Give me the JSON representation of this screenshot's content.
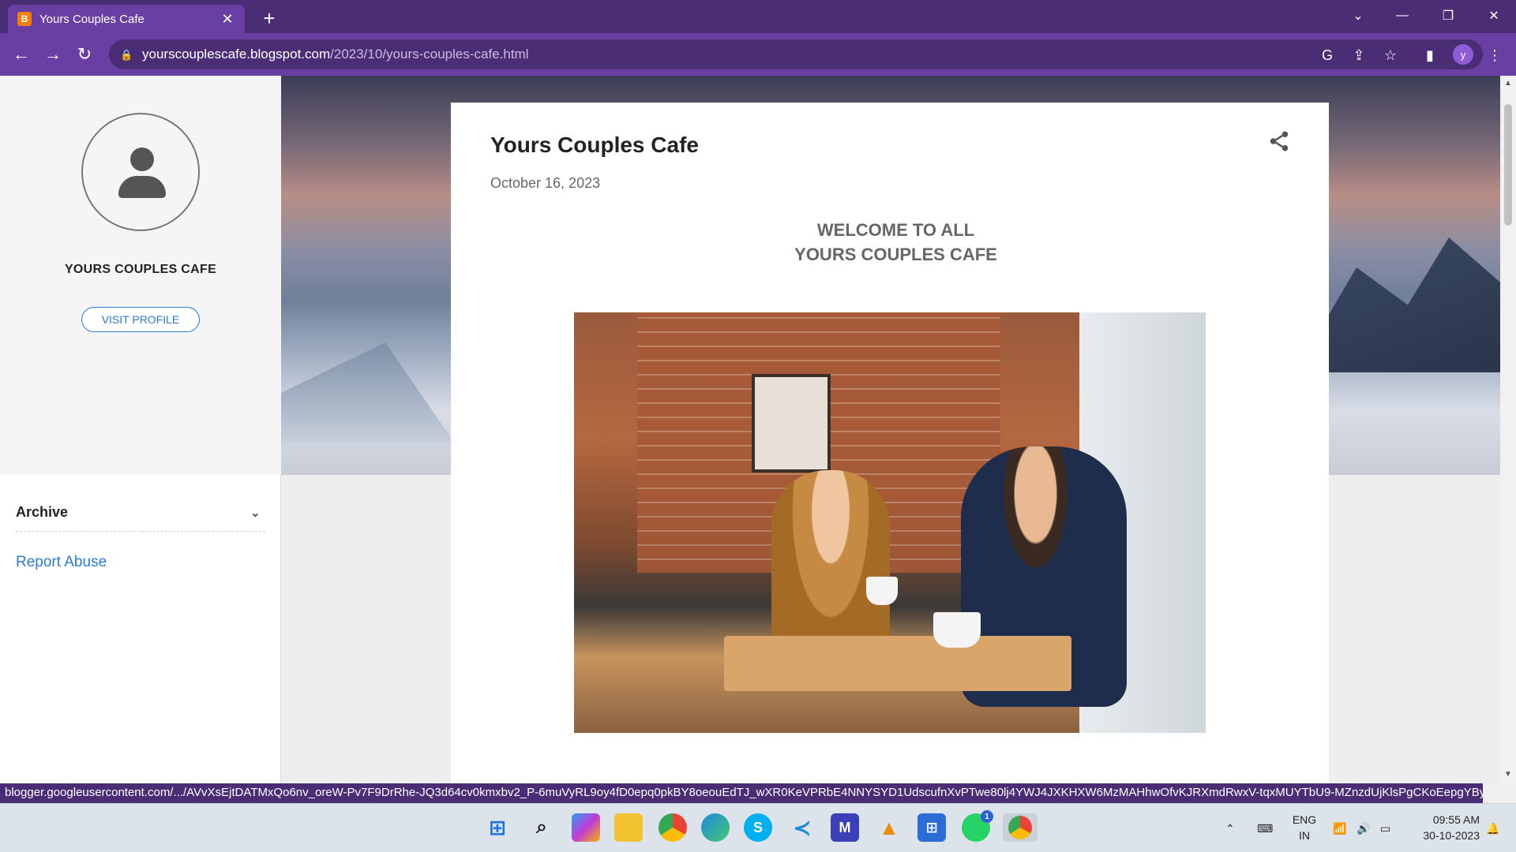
{
  "browser": {
    "tab_title": "Yours Couples Cafe",
    "tab_favicon": "blogger-icon",
    "url_host": "yourscouplescafe.blogspot.com",
    "url_path": "/2023/10/yours-couples-cafe.html",
    "profile_initial": "y",
    "accent_color": "#6a3fa3"
  },
  "sidebar": {
    "profile_name": "YOURS COUPLES CAFE",
    "visit_profile_label": "VISIT PROFILE",
    "archive_label": "Archive",
    "report_abuse_label": "Report Abuse"
  },
  "post": {
    "title": "Yours Couples Cafe",
    "date": "October 16, 2023",
    "welcome_line1": "WELCOME TO ALL",
    "welcome_line2": "YOURS COUPLES CAFE"
  },
  "status_bar": {
    "link_url": "blogger.googleusercontent.com/.../AVvXsEjtDATMxQo6nv_oreW-Pv7F9DrRhe-JQ3d64cv0kmxbv2_P-6muVyRL9oy4fD0epq0pkBY8oeouEdTJ_wXR0KeVPRbE4NNYSYD1UdscufnXvPTwe80lj4YWJ4JXKHXW6MzMAHhwOfvKJRXmdRwxV-tqxMUYTbU9-MZnzdUjKlsPgCKoEepgYByDvdvJiRb-"
  },
  "taskbar": {
    "apps": [
      "windows-start",
      "search",
      "copilot-pre",
      "file-explorer",
      "chrome",
      "edge",
      "skype",
      "vscode",
      "other-app",
      "vlc",
      "microsoft-store",
      "whatsapp",
      "chrome-profile"
    ],
    "whatsapp_badge": "1",
    "language_line1": "ENG",
    "language_line2": "IN",
    "time": "09:55 AM",
    "date": "30-10-2023"
  }
}
